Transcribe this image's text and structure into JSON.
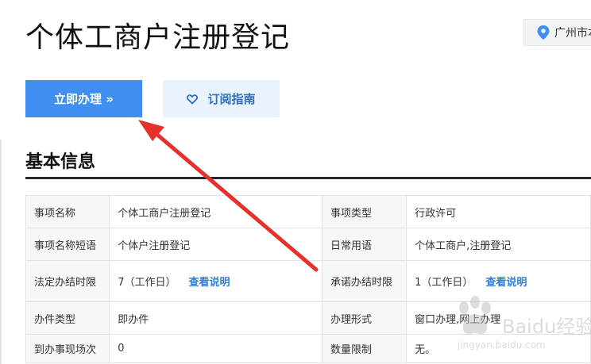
{
  "page": {
    "title": "个体工商户注册登记",
    "location": "广州市本"
  },
  "actions": {
    "apply_label": "立即办理 »",
    "subscribe_label": "订阅指南"
  },
  "section": {
    "title": "基本信息"
  },
  "info_rows": [
    {
      "l1": "事项名称",
      "v1": "个体工商户注册登记",
      "l2": "事项类型",
      "v2": "行政许可"
    },
    {
      "l1": "事项名称短语",
      "v1": "个体户注册登记",
      "l2": "日常用语",
      "v2": "个体工商户,注册登记"
    },
    {
      "l1": "法定办结时限",
      "v1": "7（工作日）",
      "link1": "查看说明",
      "l2": "承诺办结时限",
      "v2": "1（工作日）",
      "link2": "查看说明"
    },
    {
      "l1": "办件类型",
      "v1": "即办件",
      "l2": "办理形式",
      "v2": "窗口办理,网上办理"
    },
    {
      "l1": "到办事现场次",
      "v1": "0",
      "l2": "数量限制",
      "v2": "无。"
    }
  ],
  "watermark": {
    "text": "Baidu经验",
    "url": "jingyan.baidu.com"
  },
  "colors": {
    "primary": "#3f8ef0",
    "secondary_bg": "#e9f3fd",
    "link": "#2f80d8",
    "arrow": "#e8302a"
  },
  "icons": {
    "location": "map-pin-icon",
    "subscribe": "heart-icon",
    "annotation": "red-arrow"
  }
}
